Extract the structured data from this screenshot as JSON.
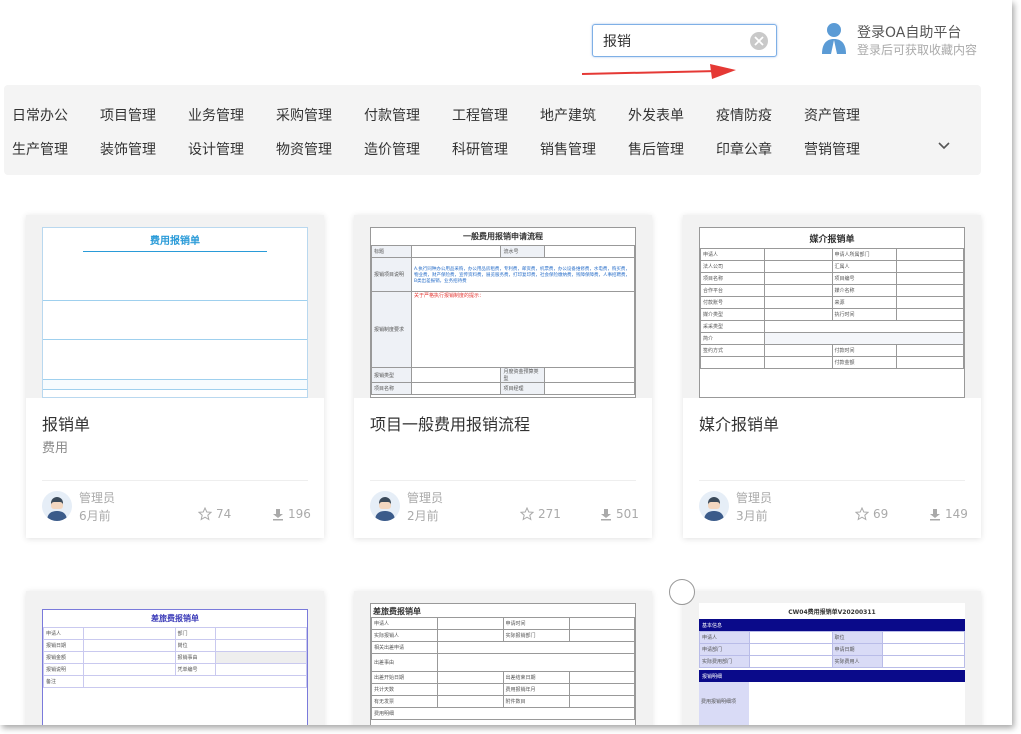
{
  "search": {
    "value": "报销"
  },
  "oa": {
    "title": "登录OA自助平台",
    "subtitle": "登录后可获取收藏内容"
  },
  "categories": {
    "row1": [
      "日常办公",
      "项目管理",
      "业务管理",
      "采购管理",
      "付款管理",
      "工程管理",
      "地产建筑",
      "外发表单",
      "疫情防疫",
      "资产管理"
    ],
    "row2": [
      "生产管理",
      "装饰管理",
      "设计管理",
      "物资管理",
      "造价管理",
      "科研管理",
      "销售管理",
      "售后管理",
      "印章公章",
      "营销管理"
    ]
  },
  "cards": [
    {
      "title": "报销单",
      "sub": "费用",
      "author": "管理员",
      "time": "6月前",
      "stars": "74",
      "downloads": "196",
      "thumb_title": "费用报销单"
    },
    {
      "title": "项目一般费用报销流程",
      "sub": "",
      "author": "管理员",
      "time": "2月前",
      "stars": "271",
      "downloads": "501",
      "thumb_title": "一般费用报销申请流程"
    },
    {
      "title": "媒介报销单",
      "sub": "",
      "author": "管理员",
      "time": "3月前",
      "stars": "69",
      "downloads": "149",
      "thumb_title": "媒介报销单"
    },
    {
      "thumb_title": "差旅费报销单"
    },
    {
      "thumb_title": "差旅费报销单"
    },
    {
      "thumb_title": "CW04费用报销单V20200311"
    }
  ],
  "thumb2": {
    "rows": [
      "标题",
      "报销项目说明",
      "报销制度要求",
      "报销类型",
      "项目名称"
    ],
    "col2": "流水号",
    "notice": "关于严格执行报销制度的提示：",
    "note": "A.执行同种办公用品采购，办公用品房租费，专利费，邮资费，机票费，办公设备维修费，水电费，购买费，物业费，财产保险费，宣传资料费，展览服务费，打印复印费，社会保险缴纳费，残障保障费，人事招聘费，B类出差报销，业务招待费",
    "type_label": "月度资金预算类型",
    "manager_label": "项目经理"
  },
  "thumb3": {
    "left": [
      "申请人",
      "法人公司",
      "项目名称",
      "合作平台",
      "付款账号",
      "媒介类型",
      "采采类型",
      "简介",
      "签约方式"
    ],
    "right": [
      "申请人所属部门",
      "汇属人",
      "项目编号",
      "媒介名称",
      "来源",
      "执行时间",
      "",
      "",
      "付款时间",
      "付款金额"
    ]
  },
  "thumb4": {
    "labels": [
      "申请人",
      "报销日期",
      "报销金额",
      "报销说明",
      "备注",
      "部门",
      "岗位",
      "报销事由",
      "凭单编号"
    ]
  },
  "thumb5": {
    "labels": [
      "申请人",
      "实际报销人",
      "相关出差申请",
      "出差事由",
      "出差开始日期",
      "共计天数",
      "有无发票",
      "费用明细",
      "申请时间",
      "实际报销部门",
      "出差结束日期",
      "费用报销年月",
      "附件数目"
    ]
  },
  "thumb6": {
    "section1": "基本信息",
    "section2": "报销明细",
    "labels": [
      "申请人",
      "申请部门",
      "实际费用部门",
      "职位",
      "申请日期",
      "实际费用人",
      "费用报销明细项"
    ]
  }
}
